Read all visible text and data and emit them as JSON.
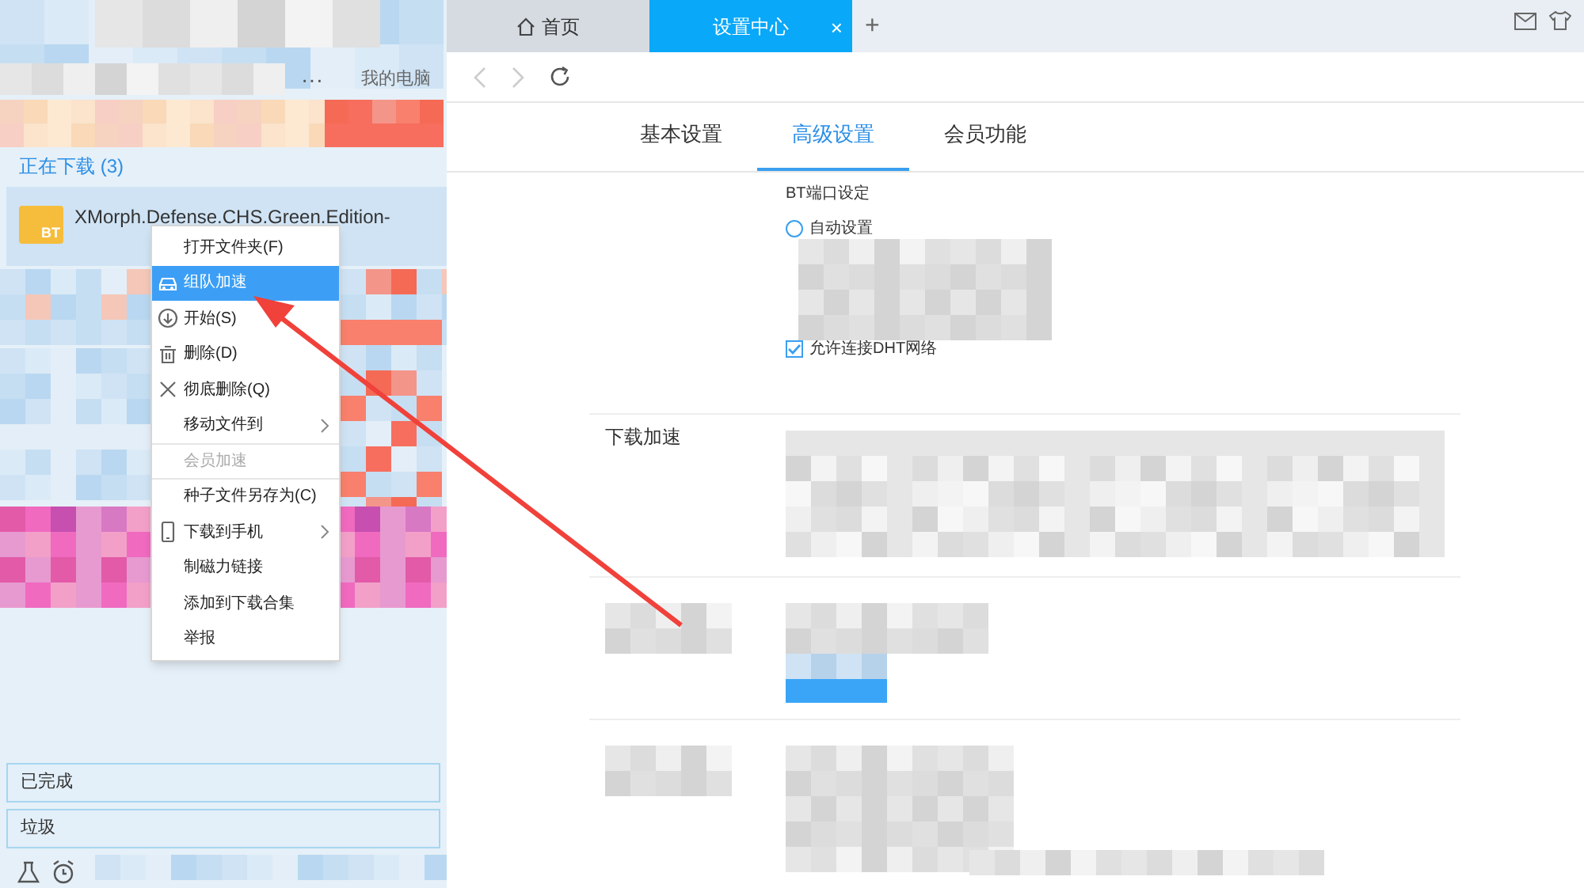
{
  "sidebar": {
    "more": "···",
    "my_computer": "我的电脑",
    "downloading": "正在下载 (3)",
    "task": {
      "name": "XMorph.Defense.CHS.Green.Edition-",
      "badge": "BT",
      "selected": true
    },
    "footer": [
      {
        "label": "已完成"
      },
      {
        "label": "垃圾"
      }
    ]
  },
  "context_menu": [
    {
      "label": "打开文件夹(F)",
      "selected": false,
      "disabled": false
    },
    {
      "label": "组队加速",
      "kind": "car",
      "selected": true,
      "disabled": false
    },
    {
      "label": "开始(S)",
      "kind": "start",
      "selected": false,
      "disabled": false
    },
    {
      "label": "删除(D)",
      "kind": "trash",
      "selected": false,
      "disabled": false
    },
    {
      "label": "彻底删除(Q)",
      "kind": "x",
      "selected": false,
      "disabled": false
    },
    {
      "label": "移动文件到",
      "submenu": true,
      "selected": false,
      "disabled": false
    },
    {
      "label": "会员加速",
      "selected": false,
      "disabled": true
    },
    {
      "label": "种子文件另存为(C)",
      "selected": false,
      "disabled": false
    },
    {
      "label": "下载到手机",
      "kind": "phone",
      "submenu": true,
      "selected": false,
      "disabled": false
    },
    {
      "label": "制磁力链接",
      "selected": false,
      "disabled": false
    },
    {
      "label": "添加到下载合集",
      "selected": false,
      "disabled": false
    },
    {
      "label": "举报",
      "selected": false,
      "disabled": false
    }
  ],
  "browser": {
    "tabs": [
      {
        "label": "首页",
        "kind": "home",
        "selected": false
      },
      {
        "label": "设置中心",
        "closable": "×",
        "selected": true
      }
    ],
    "new_tab": "+"
  },
  "settings": {
    "tabs": [
      {
        "label": "基本设置",
        "selected": false
      },
      {
        "label": "高级设置",
        "selected": true
      },
      {
        "label": "会员功能",
        "selected": false
      }
    ],
    "bt_title": "BT端口设定",
    "bt_options": [
      {
        "kind": "radio",
        "label": "自动设置",
        "checked": false
      },
      {
        "kind": "checkbox",
        "label": "允许连接DHT网络",
        "checked": true
      }
    ],
    "accel_label": "下载加速"
  }
}
